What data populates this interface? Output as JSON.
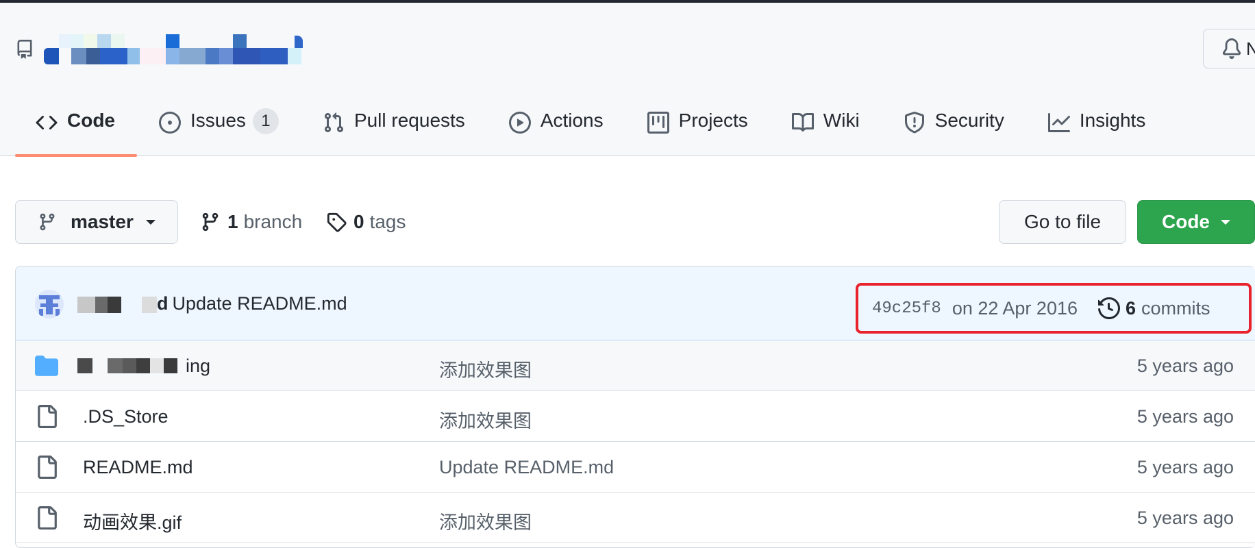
{
  "repo": {
    "notifications_label": "N"
  },
  "nav": {
    "tabs": [
      {
        "label": "Code",
        "icon": "code-icon",
        "selected": true
      },
      {
        "label": "Issues",
        "icon": "issue-opened-icon",
        "counter": "1"
      },
      {
        "label": "Pull requests",
        "icon": "git-pull-request-icon"
      },
      {
        "label": "Actions",
        "icon": "play-icon"
      },
      {
        "label": "Projects",
        "icon": "table-icon"
      },
      {
        "label": "Wiki",
        "icon": "book-icon"
      },
      {
        "label": "Security",
        "icon": "shield-icon"
      },
      {
        "label": "Insights",
        "icon": "graph-icon"
      }
    ]
  },
  "branch_bar": {
    "branch_name": "master",
    "branch_count": "1",
    "branch_word": "branch",
    "tag_count": "0",
    "tag_word": "tags",
    "go_to_file": "Go to file",
    "code_button": "Code"
  },
  "latest_commit": {
    "author_suffix": "d",
    "message": "Update README.md",
    "sha": "49c25f8",
    "date": "on 22 Apr 2016",
    "commit_count": "6",
    "commit_word": "commits"
  },
  "files": [
    {
      "type": "folder",
      "name_suffix": "ing",
      "message": "添加效果图",
      "age": "5 years ago"
    },
    {
      "type": "file",
      "name": ".DS_Store",
      "message": "添加效果图",
      "age": "5 years ago"
    },
    {
      "type": "file",
      "name": "README.md",
      "message": "Update README.md",
      "age": "5 years ago"
    },
    {
      "type": "file",
      "name": "动画效果.gif",
      "message": "添加效果图",
      "age": "5 years ago"
    }
  ],
  "colors": {
    "accent_tab_underline": "#fd8c73",
    "code_button_green": "#2da44e",
    "highlight_box_red": "#e8232c",
    "folder_blue": "#54aeff"
  }
}
